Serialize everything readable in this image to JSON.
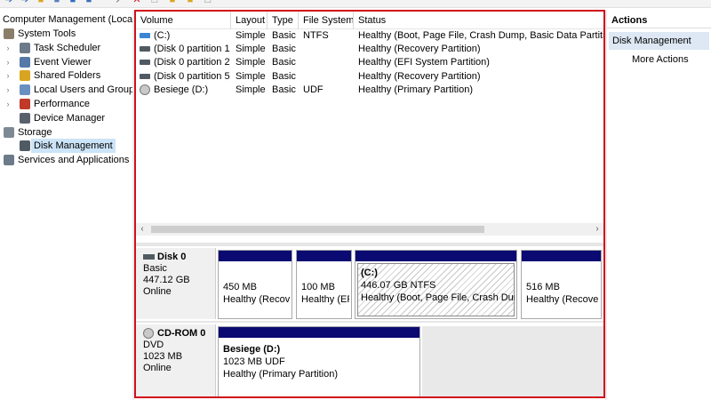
{
  "toolbar": {
    "icons": [
      "back-arrow-icon",
      "forward-arrow-icon",
      "folder-icon",
      "properties-icon",
      "help-icon",
      "connect-icon",
      "delete-icon",
      "disk-icon",
      "folder-open-icon",
      "window-icon"
    ]
  },
  "tree": {
    "root": "Computer Management (Local",
    "items": [
      {
        "label": "System Tools",
        "level": 0,
        "expanded": true,
        "icon": "tools-icon"
      },
      {
        "label": "Task Scheduler",
        "level": 1,
        "icon": "clock-icon"
      },
      {
        "label": "Event Viewer",
        "level": 1,
        "icon": "event-viewer-icon"
      },
      {
        "label": "Shared Folders",
        "level": 1,
        "icon": "shared-folder-icon"
      },
      {
        "label": "Local Users and Groups",
        "level": 1,
        "icon": "users-icon"
      },
      {
        "label": "Performance",
        "level": 1,
        "icon": "performance-icon"
      },
      {
        "label": "Device Manager",
        "level": 1,
        "icon": "device-manager-icon"
      },
      {
        "label": "Storage",
        "level": 0,
        "expanded": true,
        "icon": "storage-icon"
      },
      {
        "label": "Disk Management",
        "level": 1,
        "selected": true,
        "icon": "disk-management-icon"
      },
      {
        "label": "Services and Applications",
        "level": 0,
        "icon": "services-icon"
      }
    ]
  },
  "volumes": {
    "columns": [
      "Volume",
      "Layout",
      "Type",
      "File System",
      "Status"
    ],
    "rows": [
      {
        "volume": "(C:)",
        "layout": "Simple",
        "type": "Basic",
        "fs": "NTFS",
        "status": "Healthy (Boot, Page File, Crash Dump, Basic Data Partition)"
      },
      {
        "volume": "(Disk 0 partition 1)",
        "layout": "Simple",
        "type": "Basic",
        "fs": "",
        "status": "Healthy (Recovery Partition)"
      },
      {
        "volume": "(Disk 0 partition 2)",
        "layout": "Simple",
        "type": "Basic",
        "fs": "",
        "status": "Healthy (EFI System Partition)"
      },
      {
        "volume": "(Disk 0 partition 5)",
        "layout": "Simple",
        "type": "Basic",
        "fs": "",
        "status": "Healthy (Recovery Partition)"
      },
      {
        "volume": "Besiege (D:)",
        "layout": "Simple",
        "type": "Basic",
        "fs": "UDF",
        "status": "Healthy (Primary Partition)"
      }
    ]
  },
  "disks": [
    {
      "name": "Disk 0",
      "kind": "Basic",
      "size": "447.12 GB",
      "state": "Online",
      "partitions": [
        {
          "title": "",
          "size": "450 MB",
          "status": "Healthy (Recove"
        },
        {
          "title": "",
          "size": "100 MB",
          "status": "Healthy (EF"
        },
        {
          "title": "(C:)",
          "size": "446.07 GB NTFS",
          "status": "Healthy (Boot, Page File, Crash Dump"
        },
        {
          "title": "",
          "size": "516 MB",
          "status": "Healthy (Recove"
        }
      ]
    },
    {
      "name": "CD-ROM 0",
      "kind": "DVD",
      "size": "1023 MB",
      "state": "Online",
      "partitions": [
        {
          "title": "Besiege  (D:)",
          "size": "1023 MB UDF",
          "status": "Healthy (Primary Partition)"
        }
      ]
    }
  ],
  "actions": {
    "title": "Actions",
    "section": "Disk Management",
    "items": [
      "More Actions"
    ]
  },
  "colors": {
    "highlight_border": "#d0101c",
    "partition_bar": "#0b0a72",
    "selected_bg": "#cce4f7",
    "action_section_bg": "#dde8f4"
  }
}
